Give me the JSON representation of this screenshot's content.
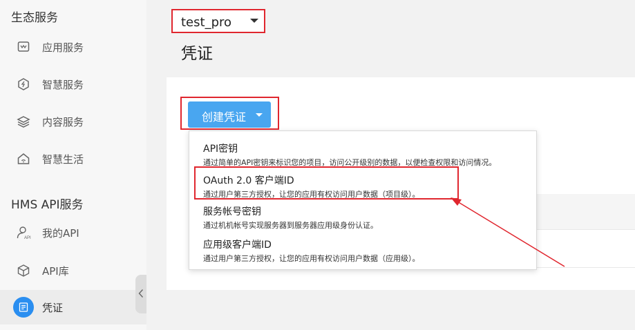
{
  "sidebar": {
    "sections": [
      {
        "title": "生态服务",
        "items": [
          {
            "label": "应用服务",
            "icon": "app-service-icon"
          },
          {
            "label": "智慧服务",
            "icon": "smart-service-icon"
          },
          {
            "label": "内容服务",
            "icon": "content-layers-icon"
          },
          {
            "label": "智慧生活",
            "icon": "smart-home-icon"
          }
        ]
      },
      {
        "title": "HMS API服务",
        "items": [
          {
            "label": "我的API",
            "icon": "user-api-icon"
          },
          {
            "label": "API库",
            "icon": "cube-icon"
          },
          {
            "label": "凭证",
            "icon": "credential-icon",
            "active": true
          }
        ]
      }
    ]
  },
  "project_select": {
    "value": "test_pro"
  },
  "page": {
    "title": "凭证"
  },
  "create_button": {
    "label": "创建凭证"
  },
  "dropdown": {
    "items": [
      {
        "title": "API密钥",
        "desc": "通过简单的API密钥来标识您的项目，访问公开级别的数据，以便检查权限和访问情况。"
      },
      {
        "title": "OAuth 2.0 客户端ID",
        "desc": "通过用户第三方授权，让您的应用有权访问用户数据（项目级）。"
      },
      {
        "title": "服务帐号密钥",
        "desc": "通过机机帐号实现服务器到服务器应用级身份认证。"
      },
      {
        "title": "应用级客户端ID",
        "desc": "通过用户第三方授权，让您的应用有权访问用户数据（应用级）。"
      }
    ]
  },
  "colors": {
    "accent": "#49a6f0",
    "highlight_border": "#e0262e",
    "active_icon_bg": "#2a8ef0"
  }
}
